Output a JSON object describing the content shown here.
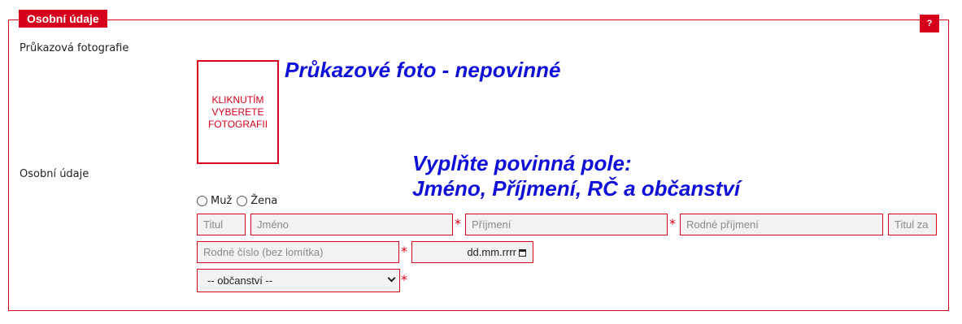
{
  "section": {
    "legend": "Osobní údaje",
    "help_label": "?"
  },
  "photo": {
    "label": "Průkazová fotografie",
    "placeholder": "KLIKNUTÍM VYBERETE FOTOGRAFII",
    "annotation": "Průkazové foto  - nepovinné"
  },
  "personal": {
    "label": "Osobní údaje",
    "annotation_line1": "Vyplňte povinná pole:",
    "annotation_line2": "Jméno, Příjmení, RČ a občanství",
    "gender_options": [
      "Muž",
      "Žena"
    ],
    "fields": {
      "titul_placeholder": "Titul",
      "jmeno_placeholder": "Jméno",
      "prijmeni_placeholder": "Příjmení",
      "rodne_prijmeni_placeholder": "Rodné příjmení",
      "titul_za_placeholder": "Titul za",
      "rodne_cislo_placeholder": "Rodné číslo (bez lomítka)",
      "date_placeholder": "dd.mm.rrrr",
      "obcanstvi_selected": "-- občanství --"
    },
    "required_mark": "*"
  },
  "colors": {
    "accent": "#d6001c",
    "annotation": "#1010d8",
    "field_bg": "#f2f2f2"
  },
  "icons": {
    "date": "calendar-icon",
    "select": "chevron-down-icon"
  }
}
